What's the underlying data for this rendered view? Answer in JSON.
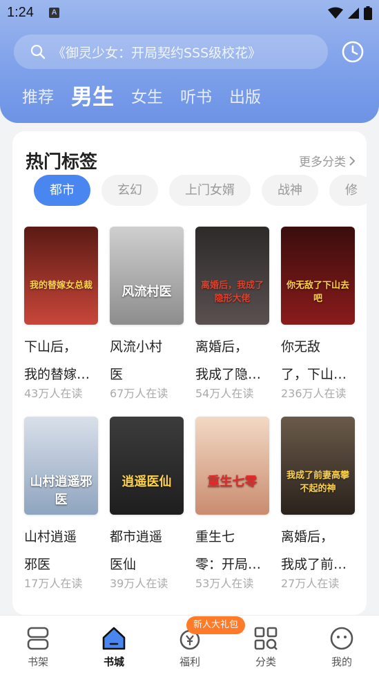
{
  "status_bar": {
    "time": "1:24",
    "notification_icon": "A"
  },
  "search": {
    "placeholder": "《御灵少女：开局契约SSS级校花》"
  },
  "tabs": [
    {
      "label": "推荐",
      "active": false
    },
    {
      "label": "男生",
      "active": true
    },
    {
      "label": "女生",
      "active": false
    },
    {
      "label": "听书",
      "active": false
    },
    {
      "label": "出版",
      "active": false
    }
  ],
  "section": {
    "title": "热门标签",
    "more_label": "更多分类"
  },
  "chips": [
    {
      "label": "都市",
      "active": true
    },
    {
      "label": "玄幻",
      "active": false
    },
    {
      "label": "上门女婿",
      "active": false
    },
    {
      "label": "战神",
      "active": false
    },
    {
      "label": "修",
      "active": false
    }
  ],
  "books": [
    {
      "title_line1": "下山后，",
      "title_line2": "我的替嫁…",
      "reads": "43万人在读",
      "cover_text": "我的替嫁女总裁",
      "cover_top": "#5a1a14",
      "cover_bottom": "#c9463a",
      "cover_text_color": "#ffd24a"
    },
    {
      "title_line1": "风流小村",
      "title_line2": "医",
      "reads": "67万人在读",
      "cover_text": "风流村医",
      "cover_top": "#cfcfcf",
      "cover_bottom": "#8d8d8d",
      "cover_text_color": "#ffffff"
    },
    {
      "title_line1": "离婚后，",
      "title_line2": "我成了隐…",
      "reads": "54万人在读",
      "cover_text": "离婚后，我成了隐形大佬",
      "cover_top": "#2d2a2a",
      "cover_bottom": "#5a5050",
      "cover_text_color": "#e0402e"
    },
    {
      "title_line1": "你无敌",
      "title_line2": "了，下山…",
      "reads": "236万人在读",
      "cover_text": "你无敌了下山去吧",
      "cover_top": "#3a0d0d",
      "cover_bottom": "#8a1b1b",
      "cover_text_color": "#ffd24a"
    },
    {
      "title_line1": "山村逍遥",
      "title_line2": "邪医",
      "reads": "17万人在读",
      "cover_text": "山村逍遥邪医",
      "cover_top": "#d9e0ea",
      "cover_bottom": "#8fa4bf",
      "cover_text_color": "#ffffff"
    },
    {
      "title_line1": "都市逍遥",
      "title_line2": "医仙",
      "reads": "39万人在读",
      "cover_text": "逍遥医仙",
      "cover_top": "#3c3c3c",
      "cover_bottom": "#1e1e1e",
      "cover_text_color": "#ffd24a"
    },
    {
      "title_line1": "重生七",
      "title_line2": "零：开局…",
      "reads": "53万人在读",
      "cover_text": "重生七零",
      "cover_top": "#f3d9c4",
      "cover_bottom": "#c98c6f",
      "cover_text_color": "#e02a2a"
    },
    {
      "title_line1": "离婚后，",
      "title_line2": "我成了前…",
      "reads": "27万人在读",
      "cover_text": "我成了前妻高攀不起的神",
      "cover_top": "#6a5a4a",
      "cover_bottom": "#2a221c",
      "cover_text_color": "#ffd24a"
    }
  ],
  "bottom_nav": {
    "promo_badge": "新人大礼包",
    "items": [
      {
        "label": "书架",
        "icon": "bookshelf-icon",
        "active": false
      },
      {
        "label": "书城",
        "icon": "bookstore-icon",
        "active": true
      },
      {
        "label": "福利",
        "icon": "welfare-icon",
        "active": false
      },
      {
        "label": "分类",
        "icon": "category-icon",
        "active": false
      },
      {
        "label": "我的",
        "icon": "profile-icon",
        "active": false
      }
    ]
  },
  "colors": {
    "accent": "#4a86f0",
    "header_top": "#9db7ee",
    "header_bottom": "#6d93e6",
    "promo": "#ff7a29"
  }
}
